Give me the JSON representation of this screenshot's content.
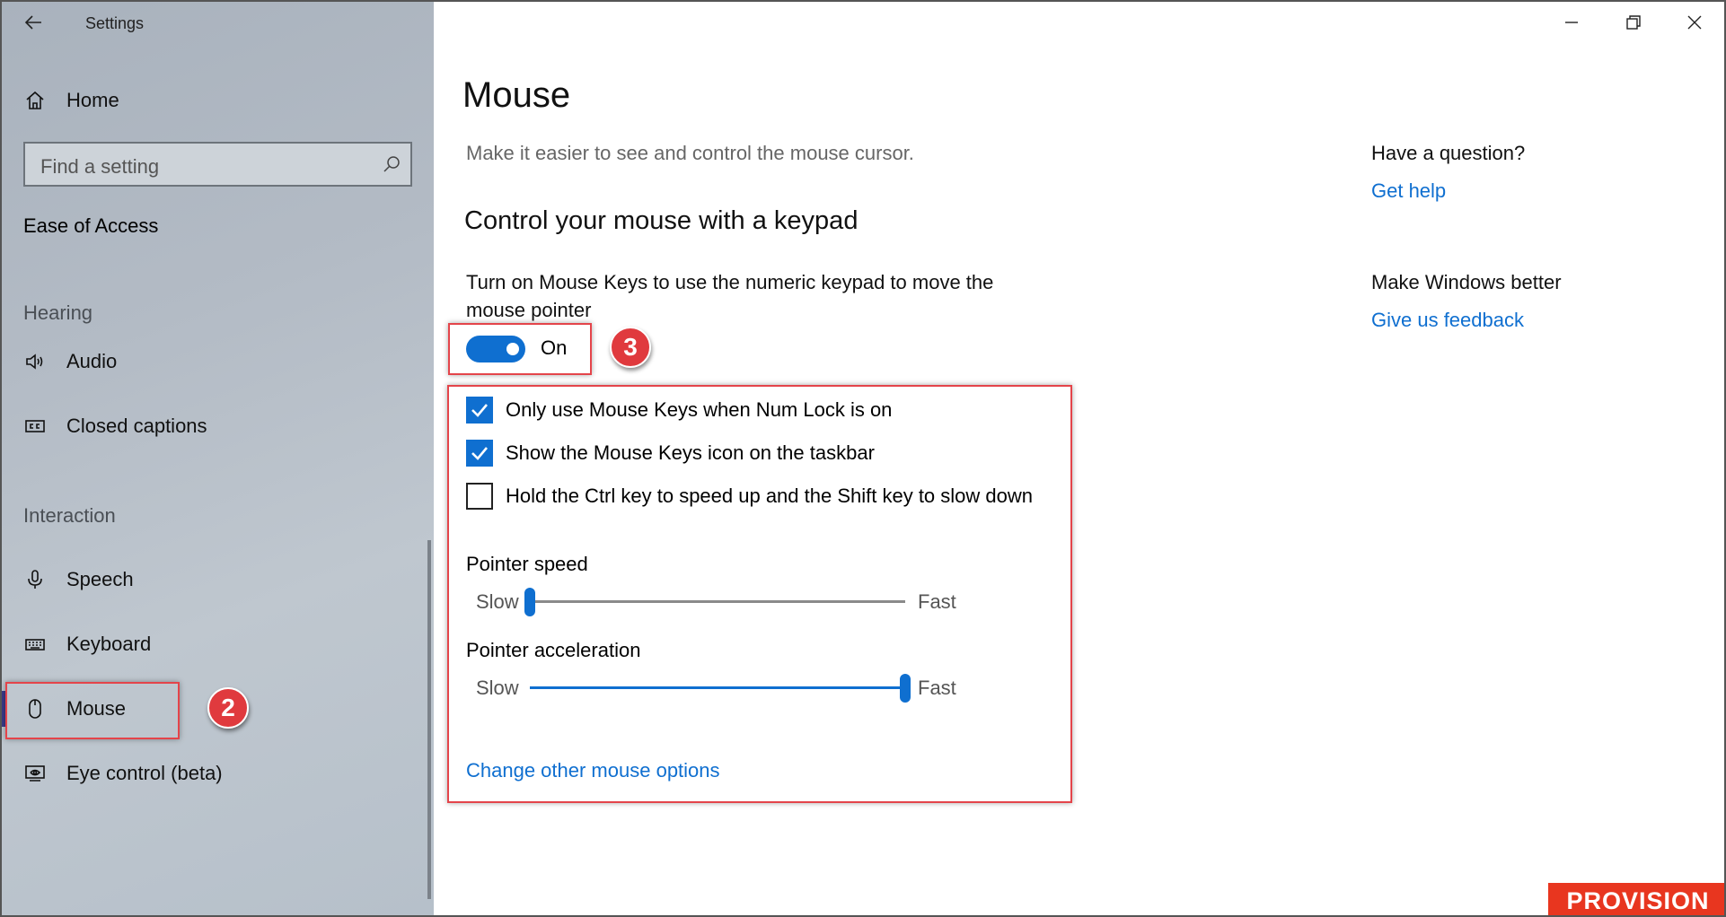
{
  "window": {
    "title": "Settings"
  },
  "sidebar": {
    "home": "Home",
    "search_placeholder": "Find a setting",
    "section": "Ease of Access",
    "groups": [
      {
        "label": "Hearing",
        "items": [
          {
            "label": "Audio",
            "icon": "speaker-icon"
          },
          {
            "label": "Closed captions",
            "icon": "cc-icon"
          }
        ]
      },
      {
        "label": "Interaction",
        "items": [
          {
            "label": "Speech",
            "icon": "microphone-icon"
          },
          {
            "label": "Keyboard",
            "icon": "keyboard-icon"
          },
          {
            "label": "Mouse",
            "icon": "mouse-icon",
            "selected": true
          },
          {
            "label": "Eye control (beta)",
            "icon": "eye-icon"
          }
        ]
      }
    ]
  },
  "main": {
    "title": "Mouse",
    "subtitle": "Make it easier to see and control the mouse cursor.",
    "section_title": "Control your mouse with a keypad",
    "description": "Turn on Mouse Keys to use the numeric keypad to move the mouse pointer",
    "toggle": {
      "label": "On",
      "on": true
    },
    "checkboxes": [
      {
        "label": "Only use Mouse Keys when Num Lock is on",
        "checked": true
      },
      {
        "label": "Show the Mouse Keys icon on the taskbar",
        "checked": true
      },
      {
        "label": "Hold the Ctrl key to speed up and the Shift key to slow down",
        "checked": false
      }
    ],
    "sliders": [
      {
        "title": "Pointer speed",
        "low": "Slow",
        "high": "Fast",
        "value": 0.0
      },
      {
        "title": "Pointer acceleration",
        "low": "Slow",
        "high": "Fast",
        "value": 1.0
      }
    ],
    "link": "Change other mouse options"
  },
  "aside": {
    "question": "Have a question?",
    "get_help": "Get help",
    "better": "Make Windows better",
    "feedback": "Give us feedback"
  },
  "annotations": {
    "step2": "2",
    "step3": "3"
  },
  "watermark": "PROVISION",
  "colors": {
    "accent": "#0f6fd0",
    "annotation": "#e4444a"
  }
}
